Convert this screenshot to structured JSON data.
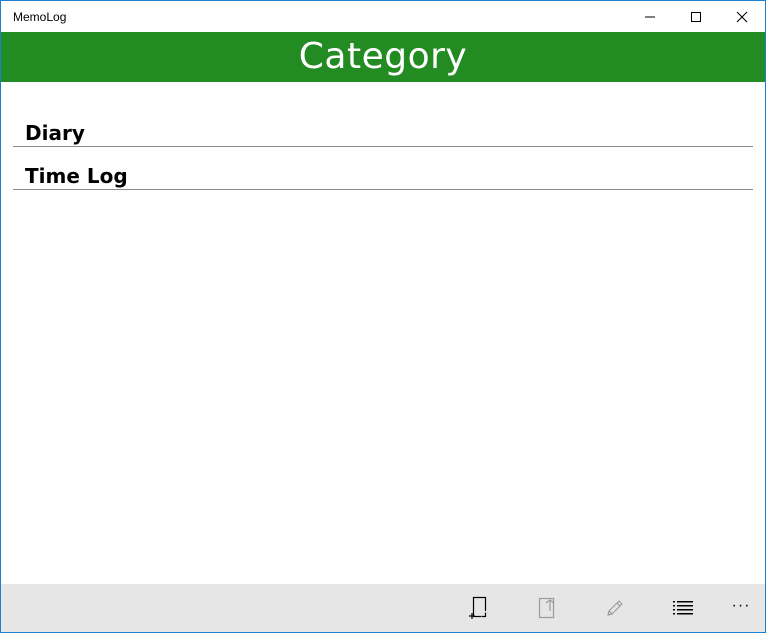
{
  "window": {
    "title": "MemoLog"
  },
  "header": {
    "title": "Category"
  },
  "categories": [
    {
      "label": "Diary"
    },
    {
      "label": "Time Log"
    }
  ],
  "command_bar": {
    "buttons": [
      {
        "icon": "new-page-icon",
        "enabled": true
      },
      {
        "icon": "move-out-icon",
        "enabled": false
      },
      {
        "icon": "edit-pencil-icon",
        "enabled": false
      },
      {
        "icon": "list-icon",
        "enabled": true
      }
    ],
    "more_label": "···"
  },
  "colors": {
    "header_bg": "#228b22",
    "command_bar_bg": "#e6e6e6",
    "disabled_icon": "#9a9a9a"
  }
}
